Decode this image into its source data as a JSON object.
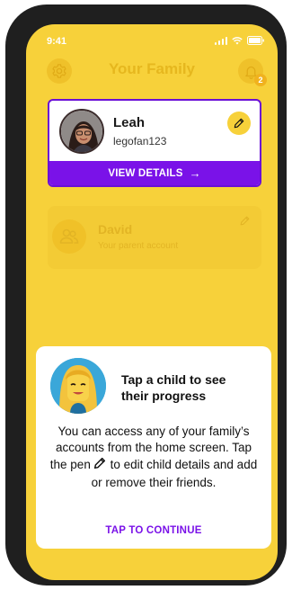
{
  "status_bar": {
    "time": "9:41"
  },
  "header": {
    "title": "Your Family",
    "notification_count": "2",
    "settings_icon": "gear-icon",
    "notification_icon": "bell-icon"
  },
  "child_card": {
    "name": "Leah",
    "username": "legofan123",
    "view_details_label": "VIEW DETAILS",
    "view_details_arrow": "→",
    "accent_color": "#7a12e8"
  },
  "parent_card": {
    "name": "David",
    "subtitle": "Your parent account"
  },
  "tooltip": {
    "title": "Tap a child to see their progress",
    "body_before_icon": "You can access any of your family’s accounts from the home screen. Tap the pen",
    "body_after_icon": "to edit child details and add or remove their friends.",
    "continue_label": "TAP TO CONTINUE"
  },
  "colors": {
    "background_yellow": "#f7d13a",
    "purple": "#7a12e8",
    "frame": "#1f1f1f"
  }
}
